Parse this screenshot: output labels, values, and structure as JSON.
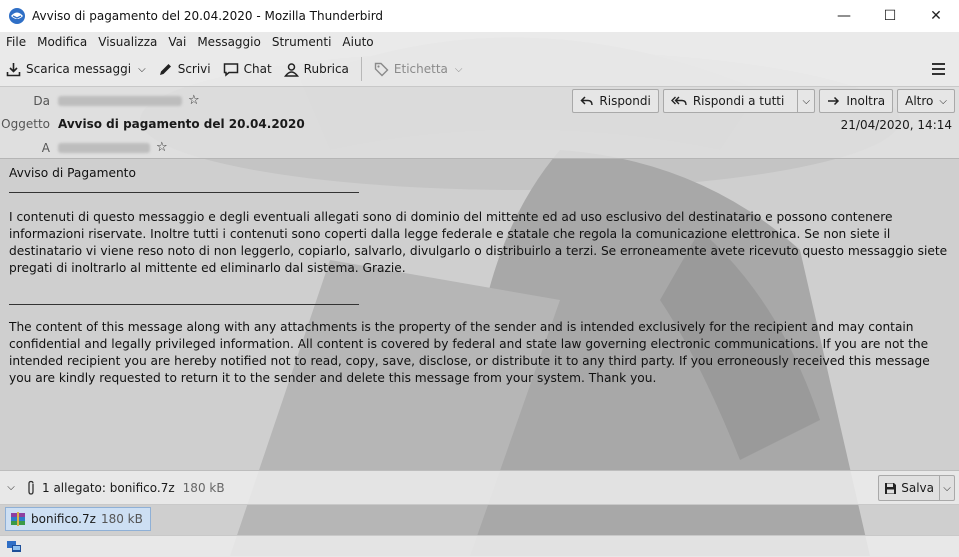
{
  "window": {
    "title": "Avviso di pagamento del 20.04.2020 - Mozilla Thunderbird",
    "controls": {
      "minimize": "—",
      "maximize": "☐",
      "close": "✕"
    }
  },
  "menu": [
    "File",
    "Modifica",
    "Visualizza",
    "Vai",
    "Messaggio",
    "Strumenti",
    "Aiuto"
  ],
  "toolbar": {
    "get_messages": "Scarica messaggi",
    "write": "Scrivi",
    "chat": "Chat",
    "address_book": "Rubrica",
    "tag": "Etichetta"
  },
  "header": {
    "from_label": "Da",
    "subject_label": "Oggetto",
    "subject": "Avviso di pagamento del 20.04.2020",
    "to_label": "A",
    "date": "21/04/2020, 14:14",
    "buttons": {
      "reply": "Rispondi",
      "reply_all": "Rispondi a tutti",
      "forward": "Inoltra",
      "more": "Altro"
    }
  },
  "body": {
    "heading": "Avviso di Pagamento",
    "italian": "I contenuti di questo messaggio e degli eventuali allegati sono di dominio del mittente ed ad uso esclusivo del destinatario e possono contenere informazioni riservate. Inoltre tutti i contenuti sono coperti dalla legge federale e statale che regola la comunicazione elettronica. Se non siete il destinatario vi viene reso noto di non leggerlo, copiarlo, salvarlo, divulgarlo o distribuirlo a terzi. Se erroneamente avete ricevuto questo messaggio siete pregati di inoltrarlo al mittente ed eliminarlo dal sistema. Grazie.",
    "english": "The content of this message along with any attachments is the property of the sender and is intended exclusively for the recipient and may contain confidential and legally privileged information. All content is covered by federal and state law governing electronic communications. If you are not the intended recipient you are hereby notified not to read, copy, save, disclose, or distribute it to any third party. If you erroneously received this message you are kindly requested to return it to the sender and delete this message from your system. Thank you."
  },
  "attachments": {
    "summary": "1 allegato: bonifico.7z",
    "total_size": "180 kB",
    "save_label": "Salva",
    "items": [
      {
        "name": "bonifico.7z",
        "size": "180 kB"
      }
    ]
  },
  "colors": {
    "attachment_highlight": "#cddff3",
    "subject_text": "#111111"
  }
}
